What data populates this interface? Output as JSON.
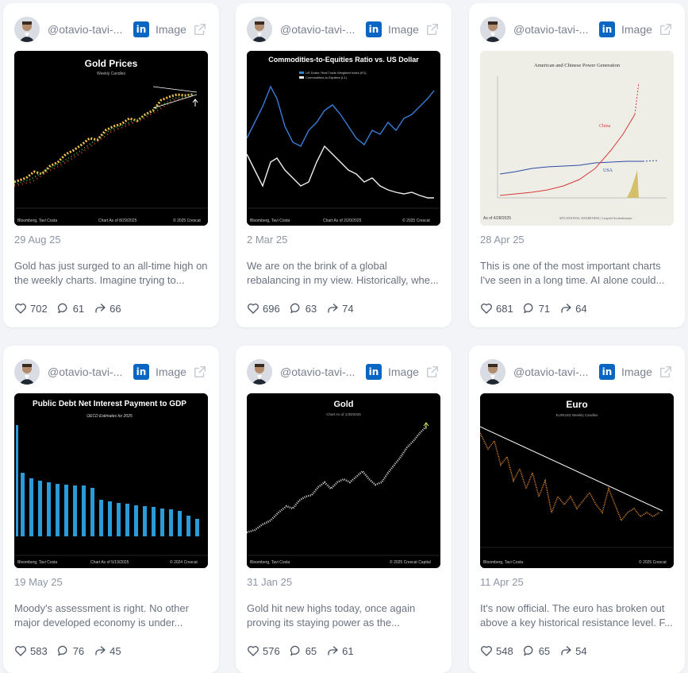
{
  "cards": [
    {
      "handle": "@otavio-tavi-...",
      "network_icon": "linkedin-icon",
      "type": "Image",
      "date": "29 Aug 25",
      "text": "Gold has just surged to an all-time high on the weekly charts. Imagine trying to...",
      "likes": "702",
      "comments": "61",
      "shares": "66",
      "thumb": {
        "title": "Gold Prices",
        "subtitle": "Weekly Candles",
        "footer_left": "Bloomberg, Tavi Costa",
        "footer_mid": "Chart As of 8/29/2025",
        "footer_right": "© 2025 Crescat"
      }
    },
    {
      "handle": "@otavio-tavi-...",
      "network_icon": "linkedin-icon",
      "type": "Image",
      "date": "2 Mar 25",
      "text": "We are on the brink of a global rebalancing in my view. Historically, whe...",
      "likes": "696",
      "comments": "63",
      "shares": "74",
      "thumb": {
        "title": "Commodities-to-Equities Ratio vs. US Dollar",
        "legend1": "US Dollar: Real Trade Weighted Index (R1)",
        "legend2": "Commodities-to-Equities (L1)",
        "footer_left": "Bloomberg, Tavi Costa",
        "footer_mid": "Chart As of 2/20/2025",
        "footer_right": "© 2025 Crescat"
      }
    },
    {
      "handle": "@otavio-tavi-...",
      "network_icon": "linkedin-icon",
      "type": "Image",
      "date": "28 Apr 25",
      "text": "This is one of the most important charts I've seen in a long time. AI alone could...",
      "likes": "681",
      "comments": "71",
      "shares": "64",
      "thumb": {
        "title": "American and Chinese Power Generation",
        "label_china": "China",
        "label_usa": "USA",
        "footer_left": "As of 4/28/2025",
        "footer_mid": "SITUATIONAL AWARENESS | Leopold Aschenbrenner"
      }
    },
    {
      "handle": "@otavio-tavi-...",
      "network_icon": "linkedin-icon",
      "type": "Image",
      "date": "19 May 25",
      "text": "Moody's assessment is right. No other major developed economy is under...",
      "likes": "583",
      "comments": "76",
      "shares": "45",
      "thumb": {
        "title": "Public Debt Net Interest Payment to GDP",
        "subtitle": "OECD Estimates for 2025",
        "footer_left": "Bloomberg, Tavi Costa",
        "footer_mid": "Chart As of 5/19/2025",
        "footer_right": "© 2024 Crescat"
      }
    },
    {
      "handle": "@otavio-tavi-...",
      "network_icon": "linkedin-icon",
      "type": "Image",
      "date": "31 Jan 25",
      "text": "Gold hit new highs today, once again proving its staying power as the...",
      "likes": "576",
      "comments": "65",
      "shares": "61",
      "thumb": {
        "title": "Gold",
        "subtitle": "Chart As of 1/30/2025",
        "footer_left": "Bloomberg, Tavi Costa",
        "footer_right": "© 2025 Crescat Capital"
      }
    },
    {
      "handle": "@otavio-tavi-...",
      "network_icon": "linkedin-icon",
      "type": "Image",
      "date": "11 Apr 25",
      "text": "It's now official. The euro has broken out above a key historical resistance level. F...",
      "likes": "548",
      "comments": "65",
      "shares": "54",
      "thumb": {
        "title": "Euro",
        "subtitle": "EURUSD Weekly Candles",
        "footer_left": "Bloomberg, Tavi Costa",
        "footer_right": "© 2025 Crescat"
      }
    }
  ]
}
